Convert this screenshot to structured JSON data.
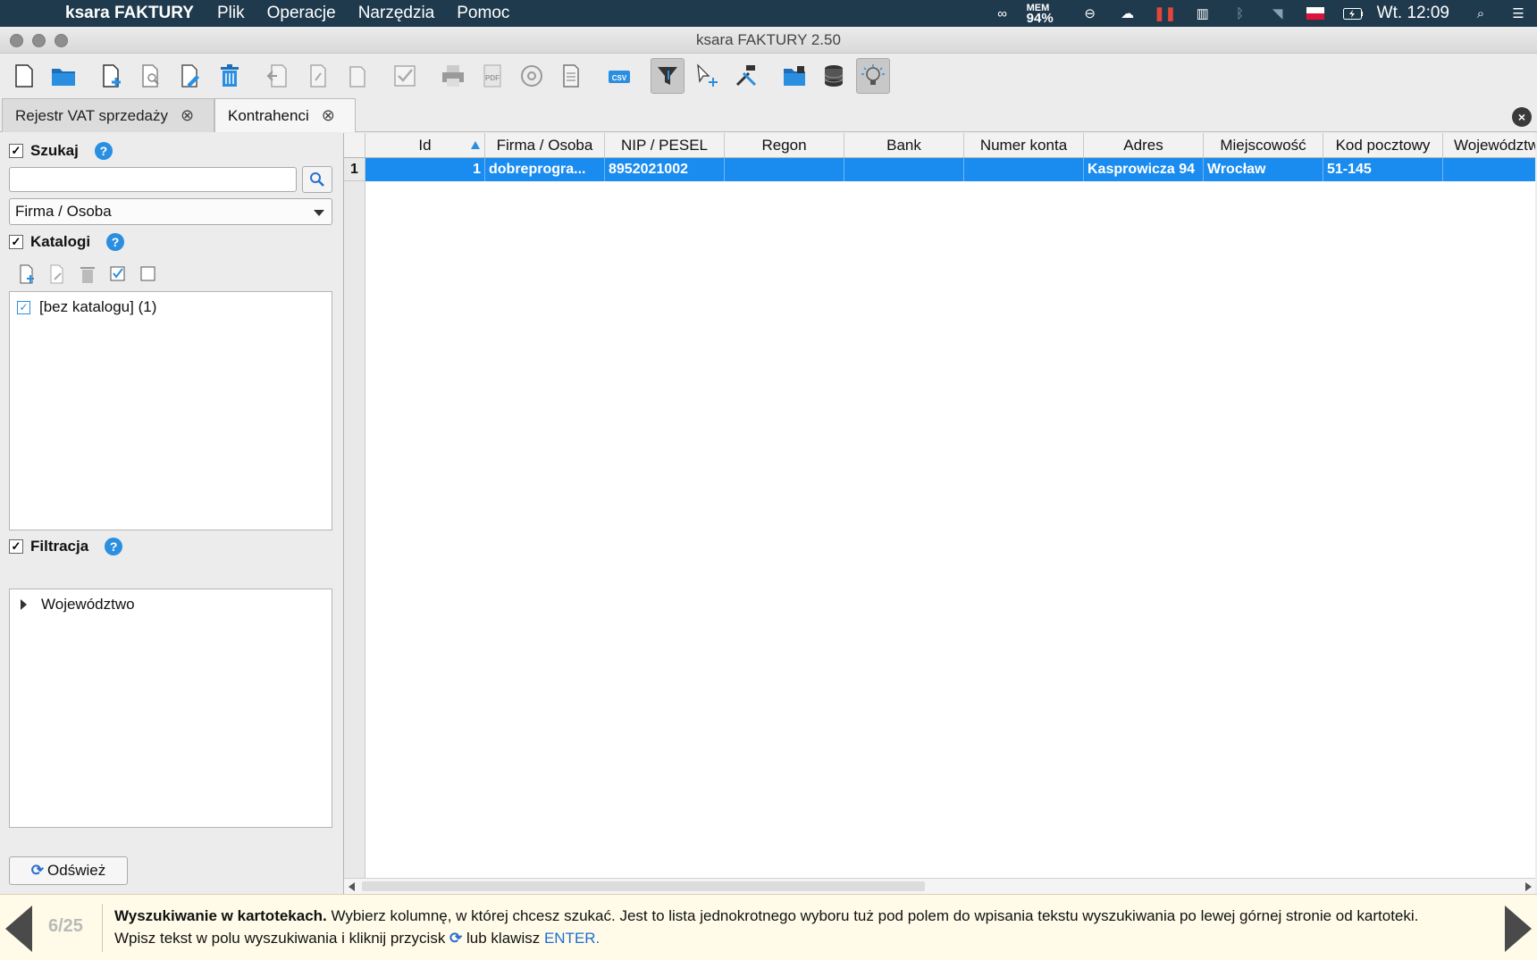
{
  "menubar": {
    "app_name": "ksara FAKTURY",
    "menus": [
      "Plik",
      "Operacje",
      "Narzędzia",
      "Pomoc"
    ],
    "mem_label": "MEM",
    "mem_value": "94%",
    "clock": "Wt. 12:09"
  },
  "window": {
    "title": "ksara FAKTURY 2.50"
  },
  "tabs": [
    {
      "label": "Rejestr VAT sprzedaży"
    },
    {
      "label": "Kontrahenci"
    }
  ],
  "left_panel": {
    "search": {
      "title": "Szukaj",
      "value": "",
      "field_select": "Firma / Osoba"
    },
    "catalogs": {
      "title": "Katalogi",
      "items": [
        "[bez katalogu] (1)"
      ]
    },
    "filters": {
      "title": "Filtracja",
      "items": [
        "Województwo"
      ]
    },
    "refresh_label": "Odśwież"
  },
  "grid": {
    "columns": [
      "Id",
      "Firma / Osoba",
      "NIP / PESEL",
      "Regon",
      "Bank",
      "Numer konta",
      "Adres",
      "Miejscowość",
      "Kod pocztowy",
      "Województwo"
    ],
    "rows": [
      {
        "num": "1",
        "cells": [
          "1",
          "dobreprogra...",
          "8952021002",
          "",
          "",
          "",
          "Kasprowicza 94",
          "Wrocław",
          "51-145",
          ""
        ]
      }
    ]
  },
  "tip": {
    "counter": "6/25",
    "title": "Wyszukiwanie w kartotekach.",
    "line1": " Wybierz kolumnę, w której chcesz szukać. Jest to lista jednokrotnego wyboru tuż pod polem do wpisania tekstu wyszukiwania po lewej górnej stronie od kartoteki.",
    "line2_a": "Wpisz tekst w polu wyszukiwania i kliknij przycisk ",
    "line2_b": " lub klawisz ",
    "enter": "ENTER."
  }
}
